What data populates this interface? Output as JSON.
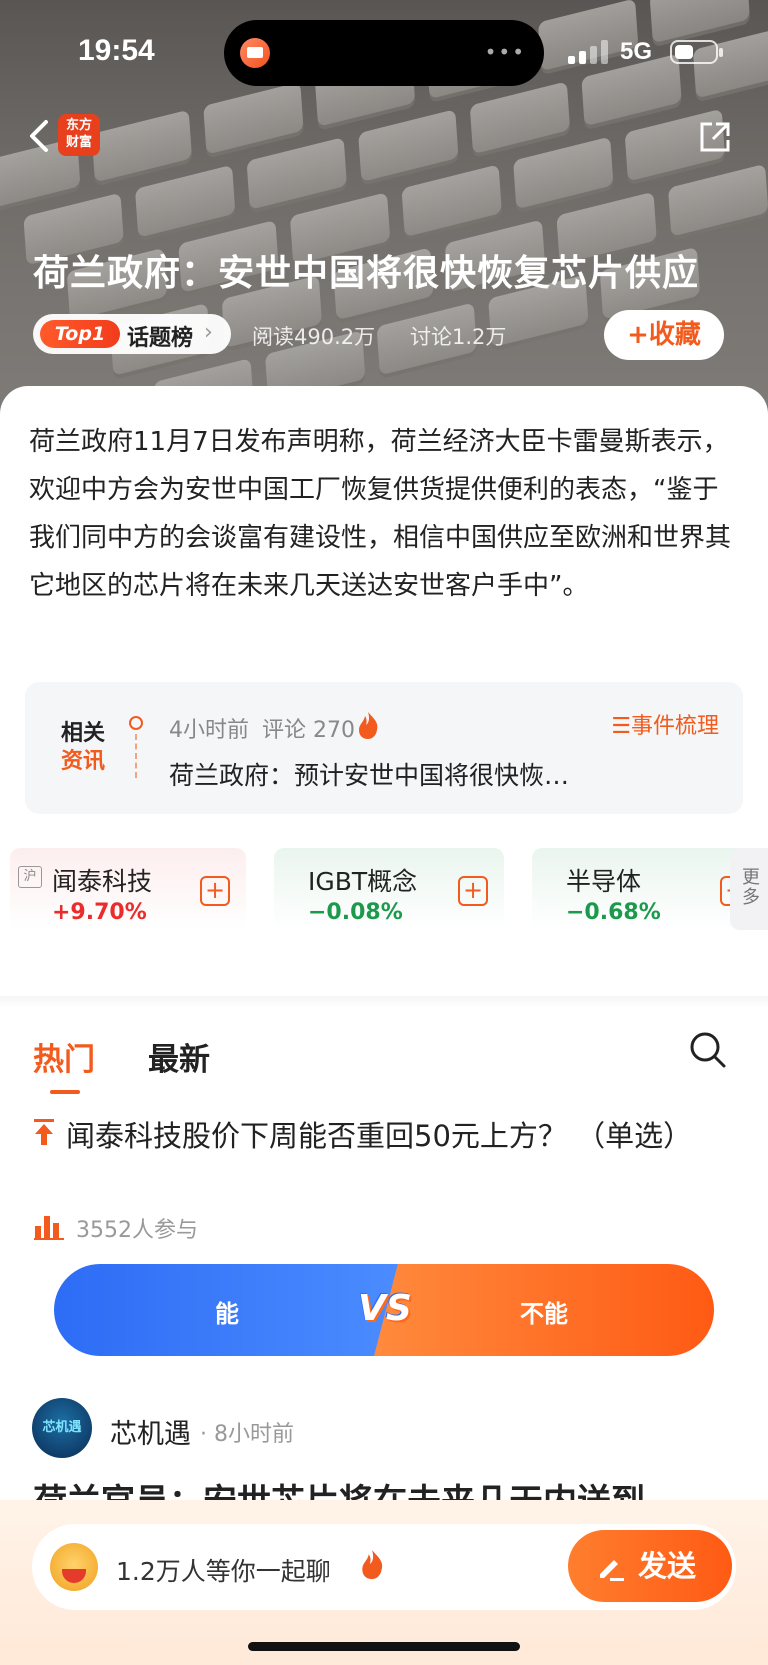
{
  "status_bar": {
    "time": "19:54",
    "network": "5G"
  },
  "header": {
    "logo_text": "东方\n财富",
    "title": "荷兰政府：安世中国将很快恢复芯片供应",
    "topic_badge": "Top1",
    "topic_label": "话题榜",
    "reads": "阅读490.2万",
    "discussions": "讨论1.2万",
    "favorite_label": "+收藏"
  },
  "summary": "荷兰政府11月7日发布声明称，荷兰经济大臣卡雷曼斯表示，欢迎中方会为安世中国工厂恢复供货提供便利的表态，“鉴于我们同中方的会谈富有建设性，相信中国供应至欧洲和世界其它地区的芯片将在未来几天送达安世客户手中”。",
  "related": {
    "mark_top": "相关",
    "mark_bottom": "资讯",
    "time": "4小时前",
    "comments": "评论 270",
    "events_link": "☰事件梳理",
    "headline": "荷兰政府：预计安世中国将很快恢…"
  },
  "stocks": [
    {
      "name": "闻泰科技",
      "change": "+9.70%",
      "exchange": "沪",
      "direction": "up"
    },
    {
      "name": "IGBT概念",
      "change": "−0.08%",
      "direction": "down"
    },
    {
      "name": "半导体",
      "change": "−0.68%",
      "direction": "down"
    }
  ],
  "more_label": "更\n多",
  "tabs": {
    "hot": "热门",
    "latest": "最新"
  },
  "poll": {
    "question": "闻泰科技股价下周能否重回50元上方？ （单选）",
    "participants": "3552人参与",
    "option_yes": "能",
    "option_no": "不能",
    "vs": "VS"
  },
  "post": {
    "avatar_text": "芯机遇",
    "author": "芯机遇",
    "time": "· 8小时前",
    "title": "荷兰官员：安世芯片将在未来几天内送到"
  },
  "bottom_bar": {
    "chat_prompt": "1.2万人等你一起聊",
    "send_label": "发送"
  },
  "colors": {
    "accent": "#f25b1d",
    "up": "#ec2b2b",
    "down": "#1c9a4c",
    "vote_yes": "#2d6cf5",
    "vote_no": "#ff5a14"
  }
}
